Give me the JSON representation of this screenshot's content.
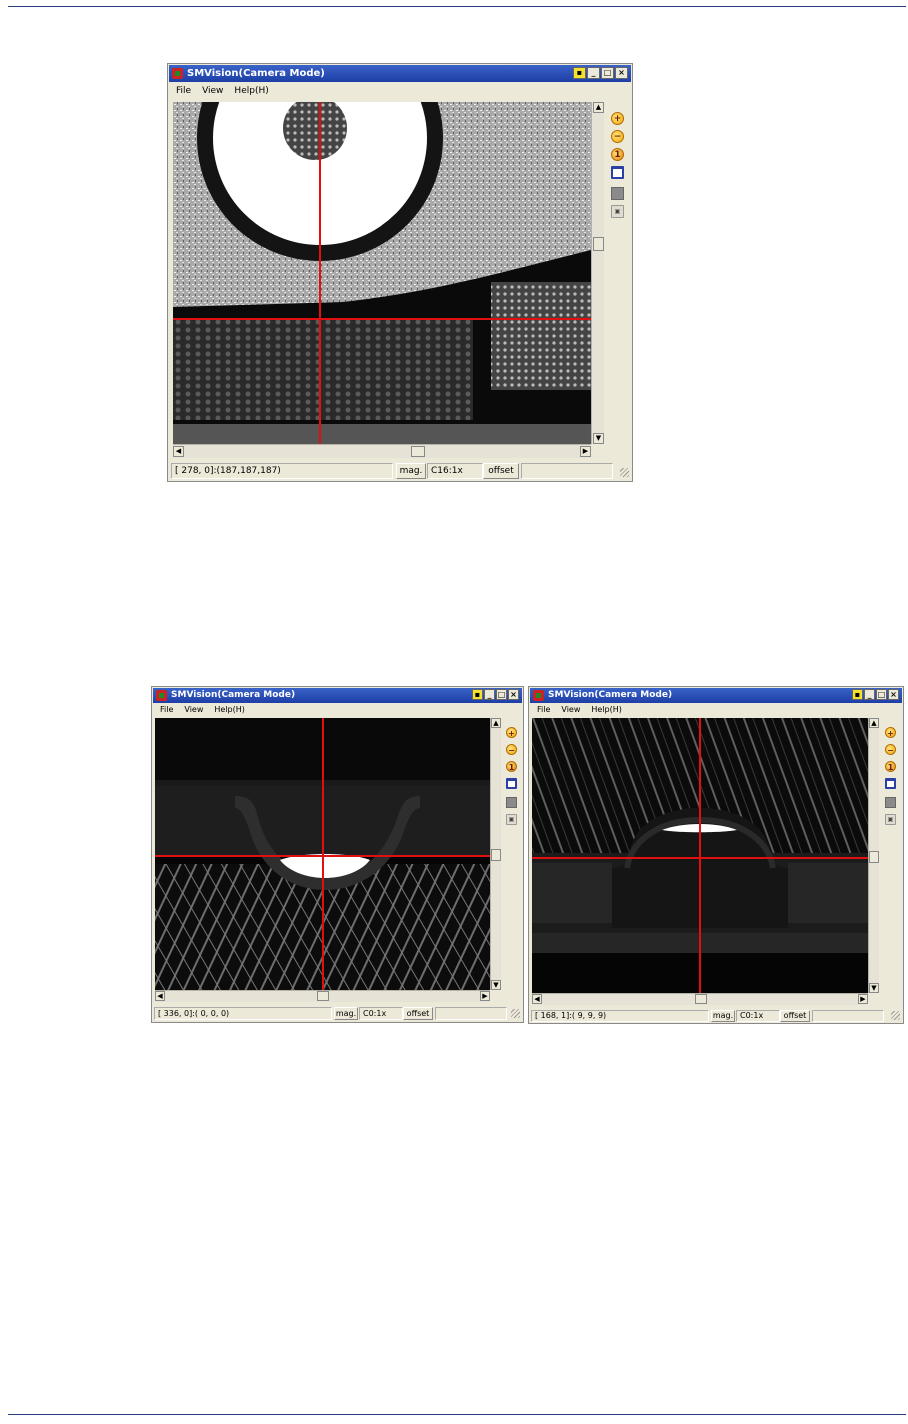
{
  "windows": [
    {
      "title": "SMVision(Camera Mode)",
      "menu": [
        "File",
        "View",
        "Help(H)"
      ],
      "title_buttons": [
        "▪",
        "_",
        "□",
        "×"
      ],
      "status": {
        "coords": "[ 278,   0]:(187,187,187)",
        "mag_label": "mag.",
        "mag_value": "C16:1x",
        "offset_label": "offset"
      }
    },
    {
      "title": "SMVision(Camera Mode)",
      "menu": [
        "File",
        "View",
        "Help(H)"
      ],
      "title_buttons": [
        "▪",
        "_",
        "□",
        "×"
      ],
      "status": {
        "coords": "[ 336,   0]:(  0,   0,   0)",
        "mag_label": "mag.",
        "mag_value": "C0:1x",
        "offset_label": "offset"
      }
    },
    {
      "title": "SMVision(Camera Mode)",
      "menu": [
        "File",
        "View",
        "Help(H)"
      ],
      "title_buttons": [
        "▪",
        "_",
        "□",
        "×"
      ],
      "status": {
        "coords": "[ 168,   1]:(  9,   9,   9)",
        "mag_label": "mag.",
        "mag_value": "C0:1x",
        "offset_label": "offset"
      }
    }
  ],
  "tools": [
    "zoom-in-icon",
    "zoom-out-icon",
    "zoom-fit-icon",
    "frame-icon",
    "gray-block-icon",
    "small-tool-icon"
  ],
  "colors": {
    "crosshair": "#e01010",
    "title_bar": "#2a4fb8",
    "rule": "#2b3b80"
  }
}
